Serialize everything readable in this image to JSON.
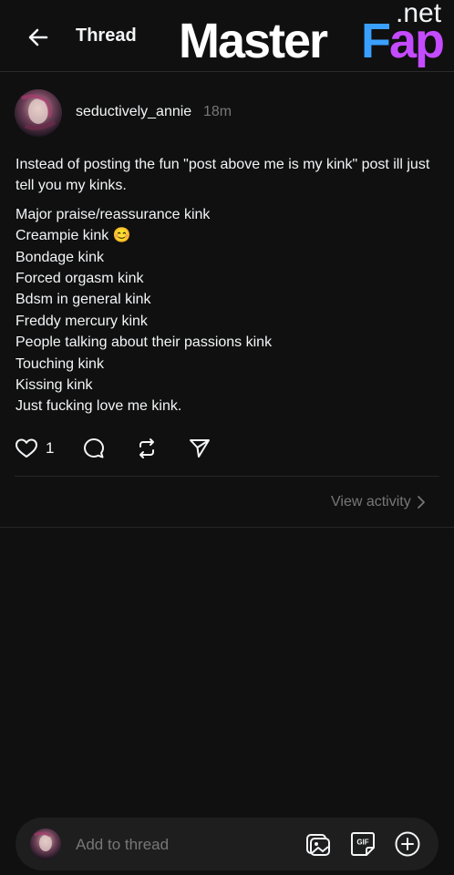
{
  "header": {
    "title": "Thread",
    "back_icon": "arrow-left-icon"
  },
  "watermark": {
    "master": "Master",
    "fap_f": "F",
    "fap_ap": "ap",
    "net": ".net"
  },
  "post": {
    "username": "seductively_annie",
    "time": "18m",
    "intro": "Instead of posting the fun \"post above me is my kink\" post ill just tell you my kinks.",
    "kinks": [
      "Major praise/reassurance kink",
      "Creampie kink 😊",
      "Bondage kink",
      "Forced orgasm kink",
      "Bdsm in general kink",
      "Freddy mercury kink",
      "People talking about their passions kink",
      "Touching kink",
      "Kissing kink",
      "Just fucking love me kink."
    ],
    "like_count": "1"
  },
  "activity": {
    "label": "View activity"
  },
  "composer": {
    "placeholder": "Add to thread",
    "gif_label": "GIF"
  },
  "colors": {
    "background": "#101010",
    "text": "#f3f5f7",
    "muted": "#777777",
    "composer_bg": "#1e1e1e"
  }
}
